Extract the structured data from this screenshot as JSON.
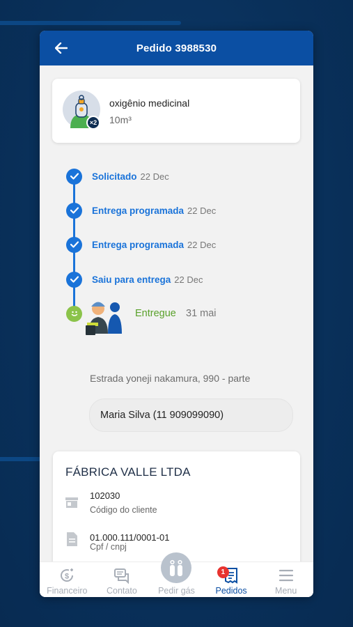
{
  "header": {
    "title": "Pedido 3988530"
  },
  "product": {
    "name": "oxigênio medicinal",
    "volume": "10m³",
    "quantity": "×2"
  },
  "timeline": [
    {
      "label": "Solicitado",
      "date": "22 Dec"
    },
    {
      "label": "Entrega programada",
      "date": "22 Dec"
    },
    {
      "label": "Entrega programada",
      "date": "22 Dec"
    },
    {
      "label": "Saiu para entrega",
      "date": "22 Dec"
    }
  ],
  "delivered": {
    "label": "Entregue",
    "date": "31 mai"
  },
  "address": "Estrada yoneji nakamura, 990 - parte",
  "contact": "Maria Silva (11 909099090)",
  "company": {
    "name": "FÁBRICA VALLE LTDA",
    "client_code": "102030",
    "client_code_label": "Código do cliente",
    "document": "01.000.111/0001-01",
    "document_label": "Cpf / cnpj"
  },
  "tabs": [
    {
      "label": "Financeiro",
      "icon": "money-icon"
    },
    {
      "label": "Contato",
      "icon": "chat-icon"
    },
    {
      "label": "Pedir gás",
      "icon": "gas-cylinders-icon"
    },
    {
      "label": "Pedidos",
      "icon": "orders-icon",
      "badge": "1",
      "active": true
    },
    {
      "label": "Menu",
      "icon": "menu-icon"
    }
  ],
  "colors": {
    "primary": "#0b4fa3",
    "timeline": "#1a73d9",
    "delivered": "#5aa12b",
    "badge": "#e8332f"
  }
}
